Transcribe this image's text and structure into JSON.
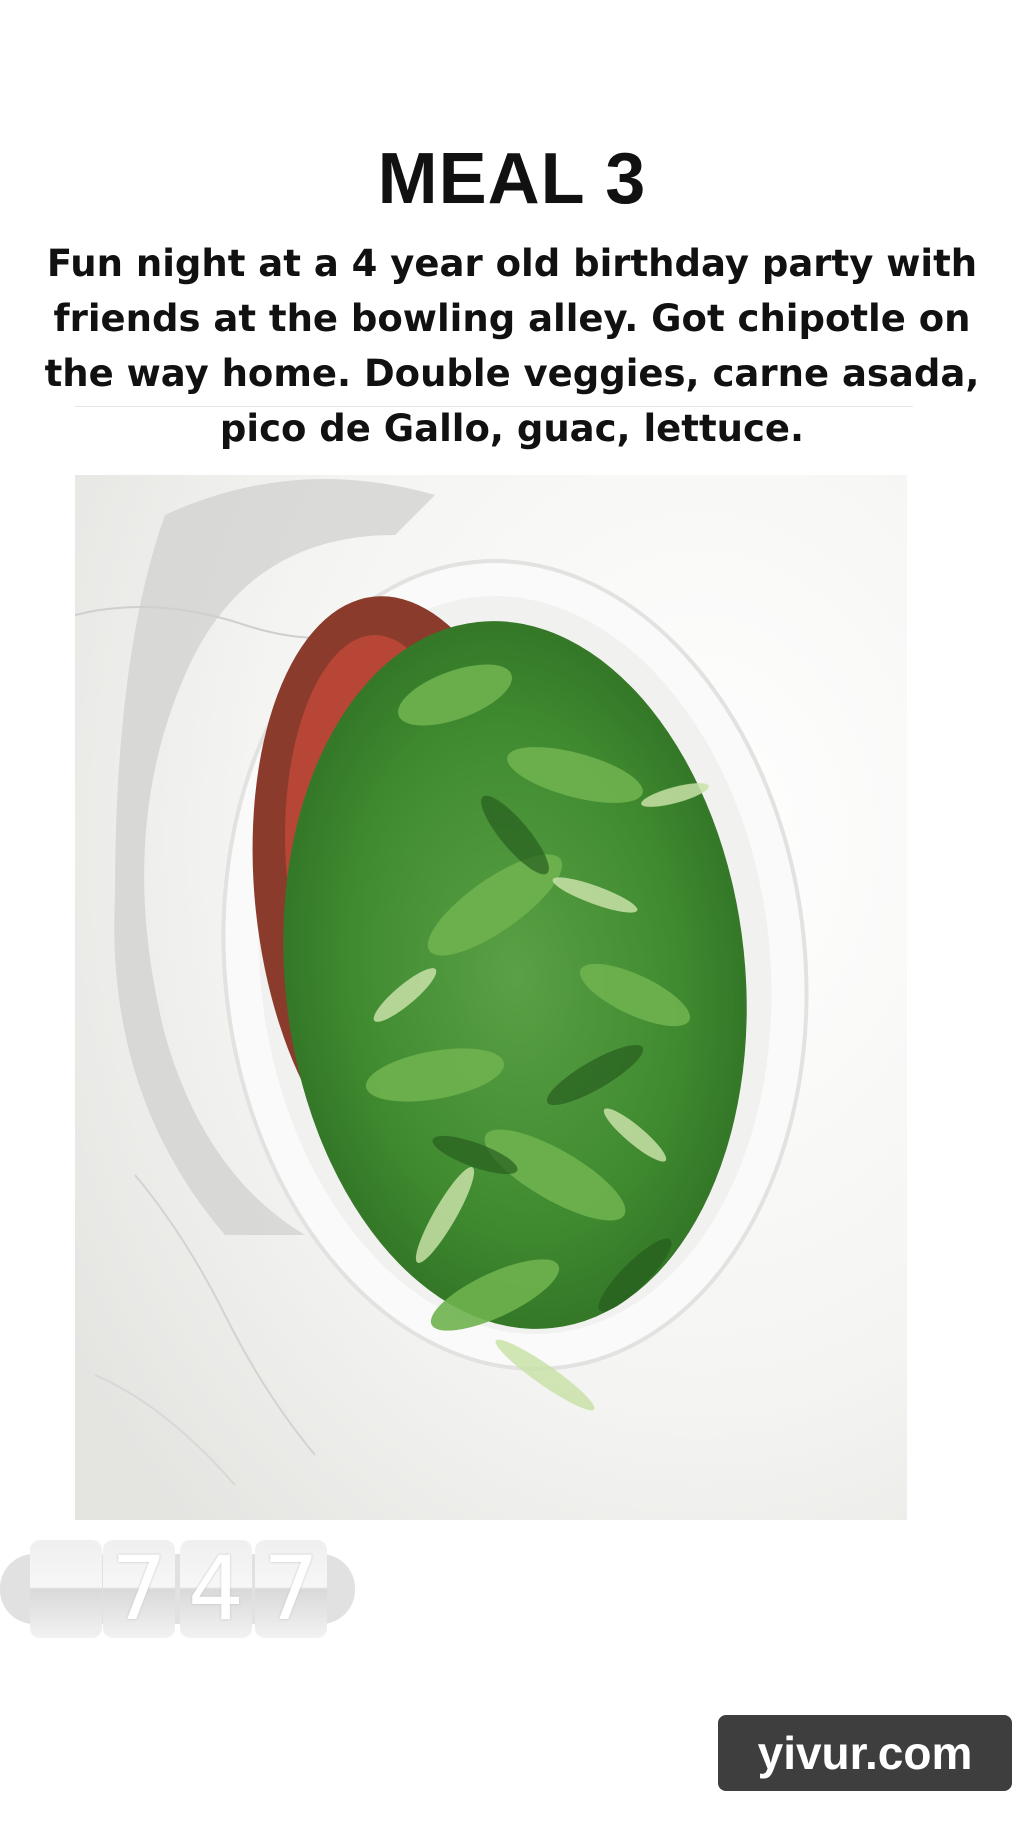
{
  "post": {
    "title": "MEAL 3",
    "caption_lines": [
      "Fun night at a 4 year old birthday party with",
      "friends at the bowling alley. Got chipotle on",
      "the way home. Double veggies, carne asada,",
      "pico de Gallo, guac, lettuce."
    ]
  },
  "photo": {
    "subject": "bowl-of-shredded-lettuce-salad"
  },
  "counter": {
    "digits": [
      "",
      "7",
      "4",
      "7"
    ]
  },
  "watermark": {
    "text": "yivur.com"
  }
}
